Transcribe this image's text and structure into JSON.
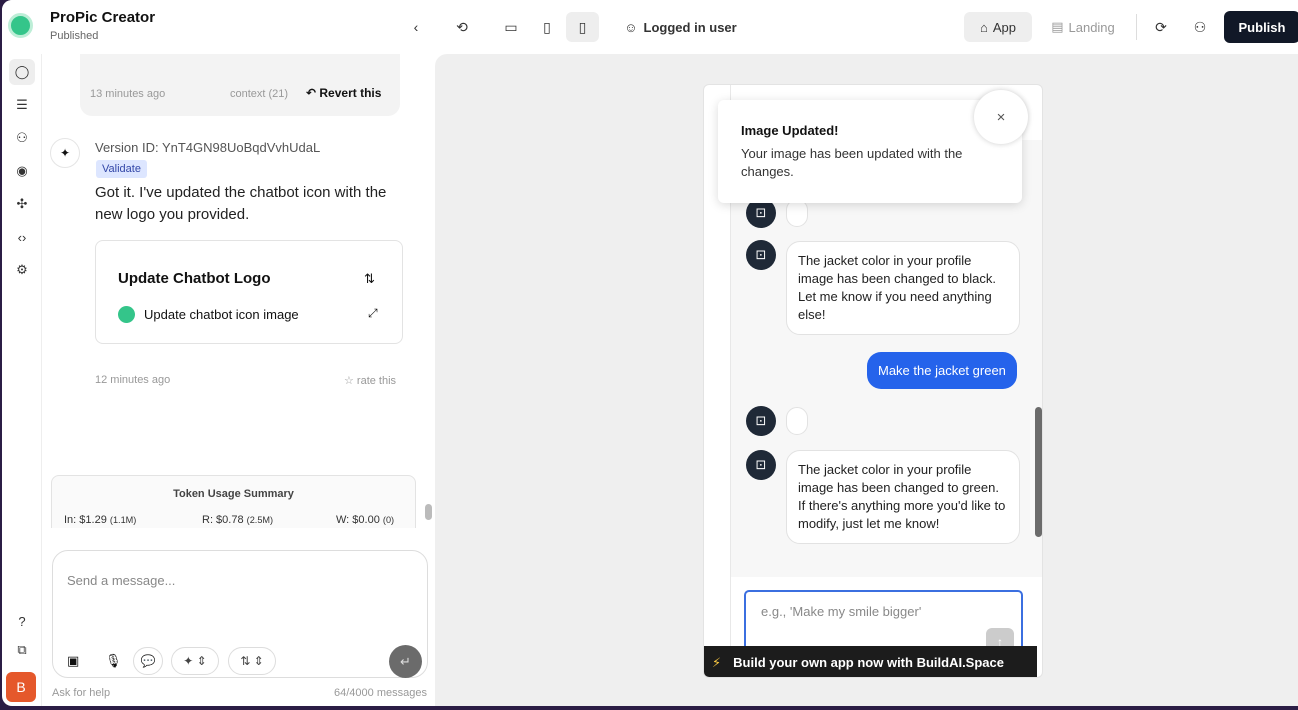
{
  "header": {
    "app_name": "ProPic Creator",
    "status": "Published",
    "user_label": "Logged in user",
    "app_tab": "App",
    "landing_tab": "Landing",
    "publish": "Publish"
  },
  "sidebar": {
    "avatar_letter": "B"
  },
  "chat": {
    "prev_time": "13 minutes ago",
    "context": "context (21)",
    "revert": "Revert this",
    "version_id": "Version ID: YnT4GN98UoBqdVvhUdaL",
    "validate": "Validate",
    "message": "Got it. I've updated the chatbot icon with the new logo you provided.",
    "card_title": "Update Chatbot Logo",
    "card_item": "Update chatbot icon image",
    "msg_time": "12 minutes ago",
    "rate": "rate this",
    "token_title": "Token Usage Summary",
    "tokens": [
      {
        "label": "In: $1.29",
        "sub": "(1.1M)"
      },
      {
        "label": "R: $0.78",
        "sub": "(2.5M)"
      },
      {
        "label": "W: $0.00",
        "sub": "(0)"
      }
    ],
    "input_placeholder": "Send a message...",
    "help": "Ask for help",
    "count": "64/4000 messages"
  },
  "preview": {
    "toast_title": "Image Updated!",
    "toast_body": "Your image has been updated with the changes.",
    "bot_msg_1": "The jacket color in your profile image has been changed to black. Let me know if you need anything else!",
    "user_msg": "Make the jacket green",
    "bot_msg_2": "The jacket color in your profile image has been changed to green. If there's anything more you'd like to modify, just let me know!",
    "input_placeholder": "e.g., 'Make my smile bigger'",
    "banner": "Build your own app now with BuildAI.Space"
  },
  "colors": {
    "accent": "#2563eb",
    "brand": "#34c58a",
    "avatar": "#e5582b",
    "dark": "#111827"
  }
}
